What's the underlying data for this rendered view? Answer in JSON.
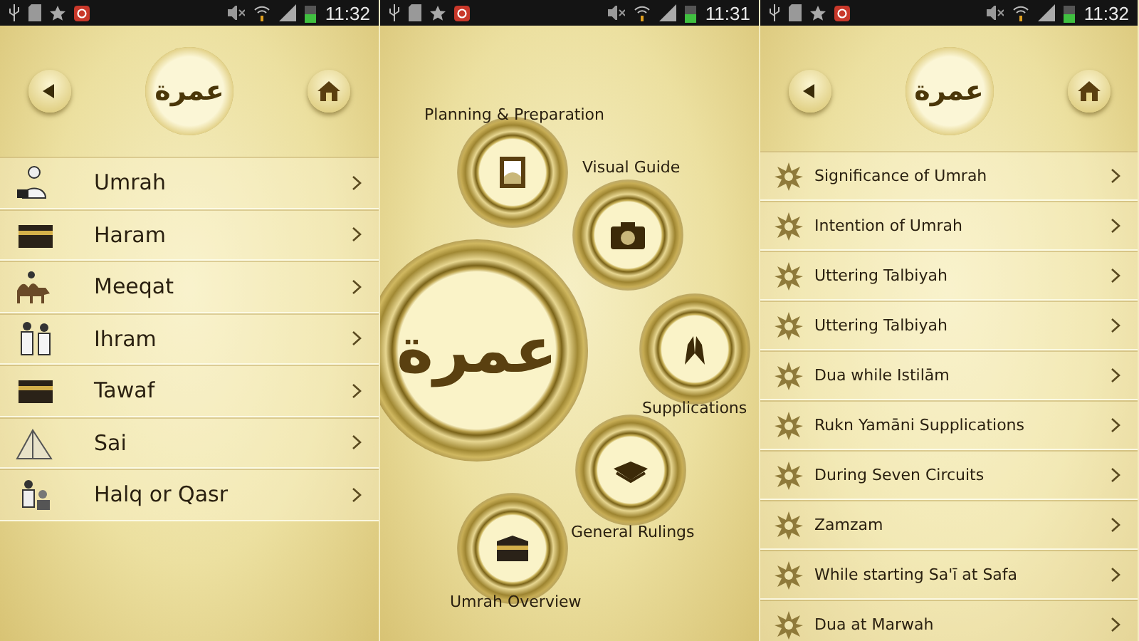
{
  "screens": [
    {
      "kind": "menu_list",
      "status_bar": {
        "time": "11:32"
      },
      "header": {
        "logo_text": "عمرة"
      },
      "items": [
        {
          "label": "Umrah"
        },
        {
          "label": "Haram"
        },
        {
          "label": "Meeqat"
        },
        {
          "label": "Ihram"
        },
        {
          "label": "Tawaf"
        },
        {
          "label": "Sai"
        },
        {
          "label": "Halq or Qasr"
        }
      ]
    },
    {
      "kind": "hub",
      "status_bar": {
        "time": "11:31"
      },
      "emblem_text": "عمرة",
      "nodes": [
        {
          "label": "Planning & Preparation"
        },
        {
          "label": "Visual Guide"
        },
        {
          "label": "Supplications"
        },
        {
          "label": "General Rulings"
        },
        {
          "label": "Umrah Overview"
        }
      ]
    },
    {
      "kind": "topic_list",
      "status_bar": {
        "time": "11:32"
      },
      "header": {
        "logo_text": "عمرة"
      },
      "items": [
        {
          "label": "Significance of Umrah"
        },
        {
          "label": "Intention of Umrah"
        },
        {
          "label": "Uttering Talbiyah"
        },
        {
          "label": "Uttering Talbiyah"
        },
        {
          "label": "Dua while Istilām"
        },
        {
          "label": "Rukn Yamāni Supplications"
        },
        {
          "label": "During Seven Circuits"
        },
        {
          "label": "Zamzam"
        },
        {
          "label": "While starting Sa'ī at Safa"
        },
        {
          "label": "Dua at Marwah"
        }
      ]
    }
  ]
}
